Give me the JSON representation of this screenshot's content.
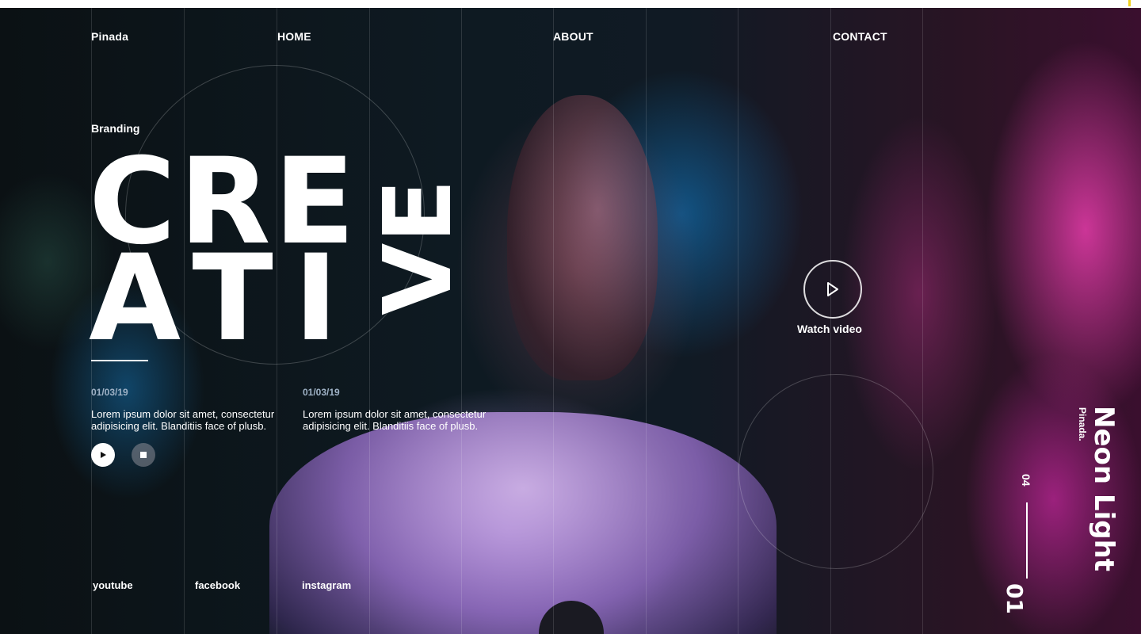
{
  "nav": {
    "brand": "Pinada",
    "home": "HOME",
    "about": "ABOUT",
    "contact": "CONTACT"
  },
  "hero": {
    "eyebrow": "Branding",
    "line1": "CRE",
    "line2": "ATI",
    "vertical": "VE"
  },
  "posts": [
    {
      "date": "01/03/19",
      "text": "Lorem ipsum dolor sit amet, consectetur adipisicing elit. Blanditiis face of plusb."
    },
    {
      "date": "01/03/19",
      "text": "Lorem ipsum dolor sit amet, consectetur adipisicing elit. Blanditiis face of plusb."
    }
  ],
  "controls": {
    "play_icon": "play-icon",
    "stop_icon": "stop-icon"
  },
  "video": {
    "label": "Watch video",
    "icon": "play-icon"
  },
  "social": {
    "youtube": "youtube",
    "facebook": "facebook",
    "instagram": "instagram"
  },
  "side": {
    "title": "Neon Light",
    "brand": "Pinada."
  },
  "pager": {
    "current": "01",
    "total": "04"
  },
  "colors": {
    "accent": "#f1d21e",
    "date": "#9fb2c6",
    "text": "#ffffff"
  }
}
